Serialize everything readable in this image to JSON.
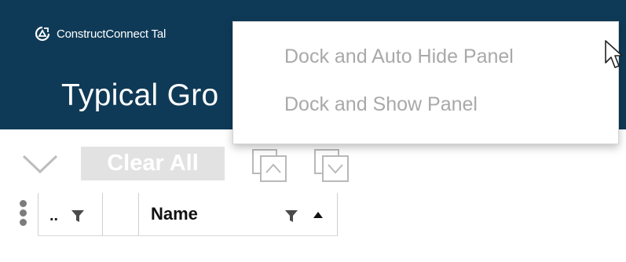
{
  "header": {
    "app_name": "ConstructConnect Tal",
    "panel_title": "Typical Gro"
  },
  "dock_menu": {
    "items": [
      {
        "label": "Dock and Auto Hide Panel"
      },
      {
        "label": "Dock and Show Panel"
      }
    ]
  },
  "toolbar": {
    "clear_all_label": "Clear All"
  },
  "grid": {
    "columns": [
      {
        "label": ".."
      },
      {
        "label": ""
      },
      {
        "label": "Name"
      }
    ]
  },
  "colors": {
    "header_bg": "#0f3a57",
    "menu_text": "#a9a9a9",
    "toggle_knob": "#7fa7d6",
    "clear_all_bg": "#e2e2e2"
  },
  "icons": [
    "logo-icon",
    "dock-panel-icon",
    "cursor-icon",
    "chevron-down-icon",
    "move-up-icon",
    "move-down-icon",
    "grip-icon",
    "filter-icon",
    "sort-ascending-icon"
  ]
}
